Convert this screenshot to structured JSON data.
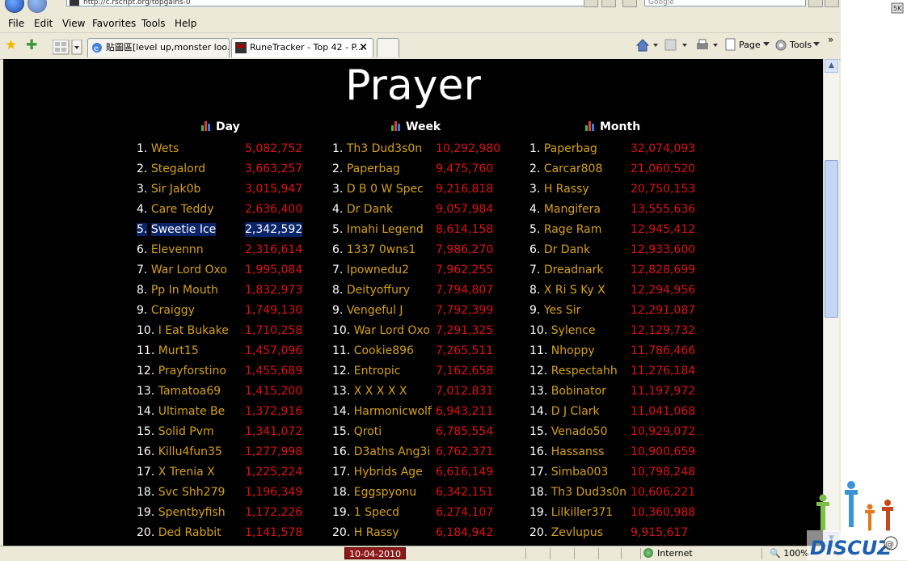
{
  "browser": {
    "address_text": "http://c.rscript.org/topgains-0",
    "search_placeholder": "Google",
    "menu": [
      "File",
      "Edit",
      "View",
      "Favorites",
      "Tools",
      "Help"
    ],
    "tabs": [
      {
        "label": "貼圖區[level up,monster loo...",
        "active": false
      },
      {
        "label": "RuneTracker - Top 42 - P...",
        "active": true
      }
    ],
    "toolbar": {
      "page": "Page",
      "tools": "Tools"
    },
    "status": {
      "date": "10-04-2010",
      "zone": "Internet",
      "zoom": "100%"
    },
    "side_text": "DISCUZ"
  },
  "page": {
    "title": "Prayer",
    "columns": [
      {
        "header": "Day",
        "rows": [
          {
            "rank": "1.",
            "name": "Wets",
            "xp": "5,082,752"
          },
          {
            "rank": "2.",
            "name": "Stegalord",
            "xp": "3,663,257"
          },
          {
            "rank": "3.",
            "name": "Sir Jak0b",
            "xp": "3,015,947"
          },
          {
            "rank": "4.",
            "name": "Care Teddy",
            "xp": "2,636,400"
          },
          {
            "rank": "5.",
            "name": "Sweetie Ice",
            "xp": "2,342,592",
            "selected": true
          },
          {
            "rank": "6.",
            "name": "Elevennn",
            "xp": "2,316,614"
          },
          {
            "rank": "7.",
            "name": "War Lord Oxo",
            "xp": "1,995,084"
          },
          {
            "rank": "8.",
            "name": "Pp In Mouth",
            "xp": "1,832,973"
          },
          {
            "rank": "9.",
            "name": "Craiggy",
            "xp": "1,749,130"
          },
          {
            "rank": "10.",
            "name": "I Eat Bukake",
            "xp": "1,710,258"
          },
          {
            "rank": "11.",
            "name": "Murt15",
            "xp": "1,457,096"
          },
          {
            "rank": "12.",
            "name": "Prayforstino",
            "xp": "1,455,689"
          },
          {
            "rank": "13.",
            "name": "Tamatoa69",
            "xp": "1,415,200"
          },
          {
            "rank": "14.",
            "name": "Ultimate Be",
            "xp": "1,372,916"
          },
          {
            "rank": "15.",
            "name": "Solid Pvm",
            "xp": "1,341,072"
          },
          {
            "rank": "16.",
            "name": "Killu4fun35",
            "xp": "1,277,998"
          },
          {
            "rank": "17.",
            "name": "X Trenia X",
            "xp": "1,225,224"
          },
          {
            "rank": "18.",
            "name": "Svc Shh279",
            "xp": "1,196,349"
          },
          {
            "rank": "19.",
            "name": "Spentbyfish",
            "xp": "1,172,226"
          },
          {
            "rank": "20.",
            "name": "Ded Rabbit",
            "xp": "1,141,578"
          }
        ]
      },
      {
        "header": "Week",
        "rows": [
          {
            "rank": "1.",
            "name": "Th3 Dud3s0n",
            "xp": "10,292,980"
          },
          {
            "rank": "2.",
            "name": "Paperbag",
            "xp": "9,475,760"
          },
          {
            "rank": "3.",
            "name": "D B 0 W Spec",
            "xp": "9,216,818"
          },
          {
            "rank": "4.",
            "name": "Dr Dank",
            "xp": "9,057,984"
          },
          {
            "rank": "5.",
            "name": "Imahi Legend",
            "xp": "8,614,158"
          },
          {
            "rank": "6.",
            "name": "1337 0wns1",
            "xp": "7,986,270"
          },
          {
            "rank": "7.",
            "name": "Ipownedu2",
            "xp": "7,962,255"
          },
          {
            "rank": "8.",
            "name": "Deityoffury",
            "xp": "7,794,807"
          },
          {
            "rank": "9.",
            "name": "Vengeful J",
            "xp": "7,792,399"
          },
          {
            "rank": "10.",
            "name": "War Lord Oxo",
            "xp": "7,291,325"
          },
          {
            "rank": "11.",
            "name": "Cookie896",
            "xp": "7,265,511"
          },
          {
            "rank": "12.",
            "name": "Entropic",
            "xp": "7,162,658"
          },
          {
            "rank": "13.",
            "name": "X X X X X",
            "xp": "7,012,831"
          },
          {
            "rank": "14.",
            "name": "Harmonicwolf",
            "xp": "6,943,211"
          },
          {
            "rank": "15.",
            "name": "Qroti",
            "xp": "6,785,554"
          },
          {
            "rank": "16.",
            "name": "D3aths Ang3i",
            "xp": "6,762,371"
          },
          {
            "rank": "17.",
            "name": "Hybrids Age",
            "xp": "6,616,149"
          },
          {
            "rank": "18.",
            "name": "Eggspyonu",
            "xp": "6,342,151"
          },
          {
            "rank": "19.",
            "name": "1 Specd",
            "xp": "6,274,107"
          },
          {
            "rank": "20.",
            "name": "H Rassy",
            "xp": "6,184,942"
          }
        ]
      },
      {
        "header": "Month",
        "rows": [
          {
            "rank": "1.",
            "name": "Paperbag",
            "xp": "32,074,093"
          },
          {
            "rank": "2.",
            "name": "Carcar808",
            "xp": "21,060,520"
          },
          {
            "rank": "3.",
            "name": "H Rassy",
            "xp": "20,750,153"
          },
          {
            "rank": "4.",
            "name": "Mangifera",
            "xp": "13,555,636"
          },
          {
            "rank": "5.",
            "name": "Rage Ram",
            "xp": "12,945,412"
          },
          {
            "rank": "6.",
            "name": "Dr Dank",
            "xp": "12,933,600"
          },
          {
            "rank": "7.",
            "name": "Dreadnark",
            "xp": "12,828,699"
          },
          {
            "rank": "8.",
            "name": "X Ri S Ky X",
            "xp": "12,294,956"
          },
          {
            "rank": "9.",
            "name": "Yes Sir",
            "xp": "12,291,087"
          },
          {
            "rank": "10.",
            "name": "Sylence",
            "xp": "12,129,732"
          },
          {
            "rank": "11.",
            "name": "Nhoppy",
            "xp": "11,786,466"
          },
          {
            "rank": "12.",
            "name": "Respectahh",
            "xp": "11,276,184"
          },
          {
            "rank": "13.",
            "name": "Bobinator",
            "xp": "11,197,972"
          },
          {
            "rank": "14.",
            "name": "D J Clark",
            "xp": "11,041,068"
          },
          {
            "rank": "15.",
            "name": "Venado50",
            "xp": "10,929,072"
          },
          {
            "rank": "16.",
            "name": "Hassanss",
            "xp": "10,900,659"
          },
          {
            "rank": "17.",
            "name": "Simba003",
            "xp": "10,798,248"
          },
          {
            "rank": "18.",
            "name": "Th3 Dud3s0n",
            "xp": "10,606,221"
          },
          {
            "rank": "19.",
            "name": "Lilkiller371",
            "xp": "10,360,988"
          },
          {
            "rank": "20.",
            "name": "Zevlupus",
            "xp": "9,915,617"
          }
        ]
      }
    ]
  },
  "colors": {
    "name": "#d4a017",
    "xp": "#e01010",
    "selection": "#0a246a",
    "background": "#000000"
  }
}
